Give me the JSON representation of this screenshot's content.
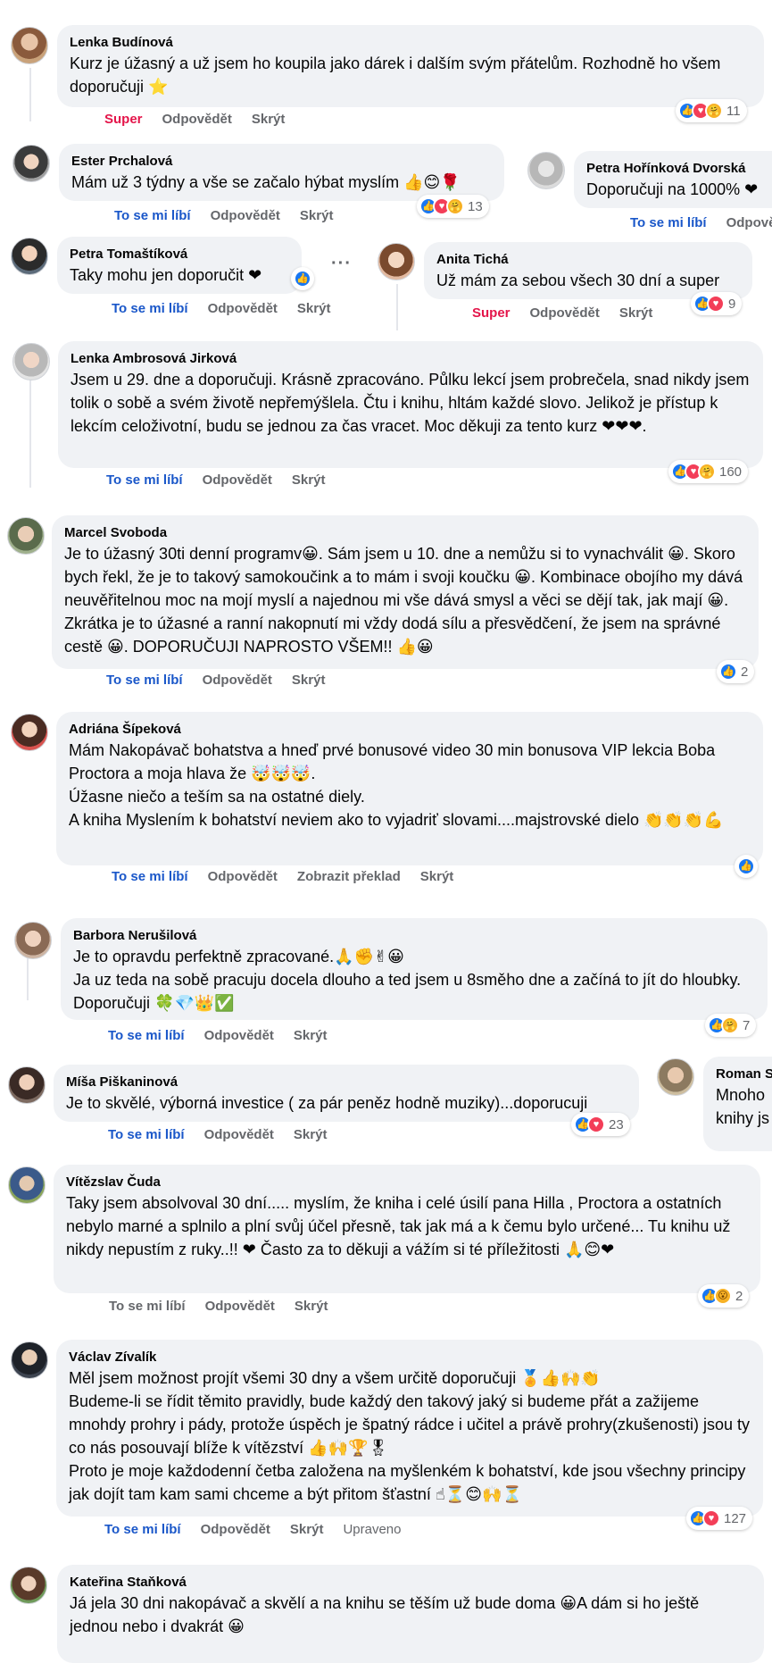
{
  "common": {
    "like": "To se mi líbí",
    "reply": "Odpovědět",
    "hide": "Skrýt",
    "super": "Super",
    "translate": "Zobrazit překlad",
    "edited": "Upraveno"
  },
  "comments": [
    {
      "name": "Lenka Budínová",
      "text": "Kurz je úžasný a už jsem ho koupila jako dárek i dalším svým přátelům. Rozhodně ho všem doporučuji ⭐",
      "reactions": "11"
    },
    {
      "name": "Ester Prchalová",
      "text": "Mám už 3 týdny a vše se začalo hýbat myslím 👍😊🌹",
      "reactions": "13"
    },
    {
      "name": "Petra Hořínková Dvorská",
      "text": "Doporučuji na 1000% ❤"
    },
    {
      "name": "Petra Tomaštíková",
      "text": "Taky mohu jen doporučit ❤"
    },
    {
      "name": "Anita Tichá",
      "text": "Už mám za sebou všech 30 dní a super",
      "reactions": "9"
    },
    {
      "name": "Lenka Ambrosová Jirková",
      "text": "Jsem u 29. dne a doporučuji. Krásně zpracováno. Půlku lekcí jsem probrečela, snad nikdy jsem tolik o sobě a svém životě nepřemýšlela. Čtu i knihu, hltám každé slovo. Jelikož je přístup k lekcím celoživotní, budu se jednou za čas vracet. Moc děkuji za tento kurz ❤❤❤.",
      "reactions": "160"
    },
    {
      "name": "Marcel Svoboda",
      "text": "Je to úžasný 30ti denní programv😀. Sám jsem u 10. dne a nemůžu si to vynachválit 😀. Skoro bych řekl, že je to takový samokoučink a to mám i svoji koučku 😀. Kombinace obojího my dává neuvěřitelnou moc na mojí myslí a najednou mi vše dává smysl a věci se dějí tak, jak mají 😀. Zkrátka je to úžasné a ranní nakopnutí mi vždy dodá sílu a přesvědčení, že jsem na správné cestě 😀. DOPORUČUJI NAPROSTO VŠEM!! 👍😀",
      "reactions": "2"
    },
    {
      "name": "Adriána Šípeková",
      "lines": [
        "Mám Nakopávač bohatstva a hneď prvé bonusové video 30 min bonusova VIP lekcia Boba Proctora a moja hlava že 🤯🤯🤯.",
        "Úžasne niečo a teším sa na ostatné diely.",
        "A kniha Myslením k bohatství neviem ako to vyjadriť slovami....majstrovské dielo 👏👏👏💪"
      ]
    },
    {
      "name": "Barbora Nerušilová",
      "lines": [
        "Je to opravdu perfektně zpracované.🙏✊✌😀",
        "Ja uz teda na sobě pracuju docela dlouho a ted jsem u 8směho dne a začíná to jít do hloubky. Doporučuji 🍀💎👑✅"
      ],
      "reactions": "7"
    },
    {
      "name": "Míša Piškaninová",
      "text": "Je to skvělé, výborná investice ( za pár peněz hodně muziky)...doporucuji",
      "reactions": "23"
    },
    {
      "name": "Roman S",
      "text": "Mnoho knihy js"
    },
    {
      "name": "Vítězslav Čuda",
      "text": "Taky jsem absolvoval 30 dní..... myslím, že kniha i celé úsilí pana Hilla , Proctora a ostatních nebylo marné a splnilo a plní svůj účel přesně, tak jak má a k čemu bylo určené... Tu knihu už nikdy nepustím z ruky..!! ❤ Často za to děkuji a vážím si té příležitosti 🙏😊❤",
      "reactions": "2"
    },
    {
      "name": "Václav Zívalík",
      "lines": [
        "Měl jsem možnost projít všemi 30 dny a všem určitě doporučuji 🏅👍🙌👏",
        "Budeme-li se řídit těmito pravidly, bude každý den takový jaký si budeme přát a zažijeme mnohdy prohry i pády, protože úspěch je špatný rádce i učitel a právě prohry(zkušenosti) jsou ty co nás posouvají blíže k vítězství 👍🙌🏆🎖",
        "Proto je moje každodenní četba založena na myšlenkém k bohatství, kde jsou všechny principy jak dojít tam kam sami chceme a být přitom šťastní ☝⏳😊🙌⏳"
      ],
      "reactions": "127"
    },
    {
      "name": "Kateřina Staňková",
      "text": "Já jela 30 dni nakopávač a skvělí a na knihu se těším už bude doma 😀A dám si ho ještě jednou nebo i dvakrát 😀"
    }
  ]
}
